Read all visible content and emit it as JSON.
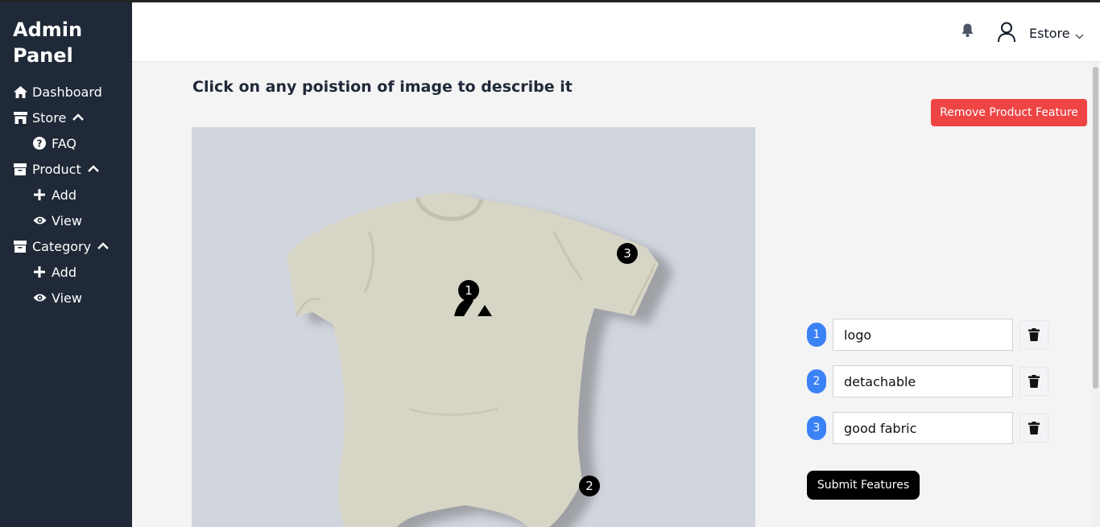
{
  "sidebar": {
    "brand": "Admin Panel",
    "items": [
      {
        "label": "Dashboard",
        "icon": "home-icon"
      },
      {
        "label": "Store",
        "icon": "store-icon",
        "expanded": true
      },
      {
        "label": "FAQ",
        "icon": "question-circle-icon"
      },
      {
        "label": "Product",
        "icon": "box-icon",
        "expanded": true
      },
      {
        "label": "Add",
        "icon": "plus-icon"
      },
      {
        "label": "View",
        "icon": "eye-icon"
      },
      {
        "label": "Category",
        "icon": "box-icon",
        "expanded": true
      },
      {
        "label": "Add",
        "icon": "plus-icon"
      },
      {
        "label": "View",
        "icon": "eye-icon"
      }
    ]
  },
  "topbar": {
    "user_name": "Estore"
  },
  "main": {
    "heading": "Click on any poistion of image to describe it",
    "remove_button": "Remove Product Feature",
    "submit_button": "Submit Features",
    "markers": [
      "1",
      "2",
      "3"
    ],
    "features": [
      {
        "number": "1",
        "value": "logo"
      },
      {
        "number": "2",
        "value": "detachable"
      },
      {
        "number": "3",
        "value": "good fabric"
      }
    ]
  },
  "colors": {
    "sidebar_bg": "#1f2937",
    "danger": "#ef4444",
    "badge_blue": "#3b82f6",
    "image_bg": "#d1d5dd",
    "garment": "#d7d5c6"
  }
}
